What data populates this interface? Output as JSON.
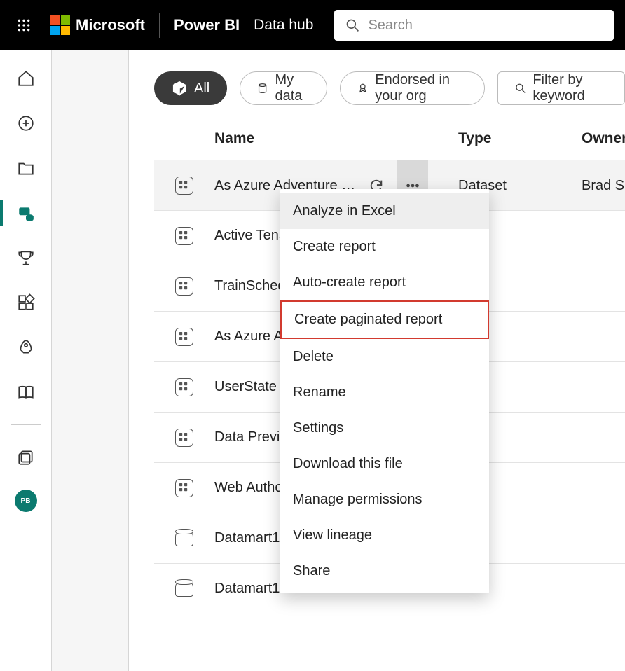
{
  "header": {
    "brand": "Microsoft",
    "app": "Power BI",
    "page": "Data hub",
    "search_placeholder": "Search"
  },
  "left_rail": {
    "avatar_initials": "PB"
  },
  "filters": {
    "all": "All",
    "my_data": "My data",
    "endorsed": "Endorsed in your org",
    "filter_by_keyword": "Filter by keyword"
  },
  "columns": {
    "name": "Name",
    "type": "Type",
    "owner": "Owner"
  },
  "rows": [
    {
      "name": "As Azure Adventure …",
      "type": "Dataset",
      "owner": "Brad S",
      "icon": "dataset",
      "hovered": true
    },
    {
      "name": "Active Tenants & Renders",
      "type": "",
      "owner": "",
      "icon": "dataset"
    },
    {
      "name": "TrainScheduleStatus",
      "type": "",
      "owner": "",
      "icon": "dataset"
    },
    {
      "name": "As Azure Adventure Works II",
      "type": "",
      "owner": "",
      "icon": "dataset"
    },
    {
      "name": "UserState",
      "type": "",
      "owner": "",
      "icon": "dataset"
    },
    {
      "name": "Data Preview Usage",
      "type": "",
      "owner": "",
      "icon": "dataset"
    },
    {
      "name": "Web Authoring Usage",
      "type": "",
      "owner": "",
      "icon": "dataset"
    },
    {
      "name": "Datamart1",
      "type": "",
      "owner": "",
      "icon": "datamart"
    },
    {
      "name": "Datamart1",
      "type": "",
      "owner": "",
      "icon": "datamart"
    }
  ],
  "context_menu": {
    "items": [
      {
        "label": "Analyze in Excel",
        "hover": true
      },
      {
        "label": "Create report"
      },
      {
        "label": "Auto-create report"
      },
      {
        "label": "Create paginated report",
        "highlight": true
      },
      {
        "label": "Delete"
      },
      {
        "label": "Rename"
      },
      {
        "label": "Settings"
      },
      {
        "label": "Download this file"
      },
      {
        "label": "Manage permissions"
      },
      {
        "label": "View lineage"
      },
      {
        "label": "Share"
      }
    ]
  }
}
